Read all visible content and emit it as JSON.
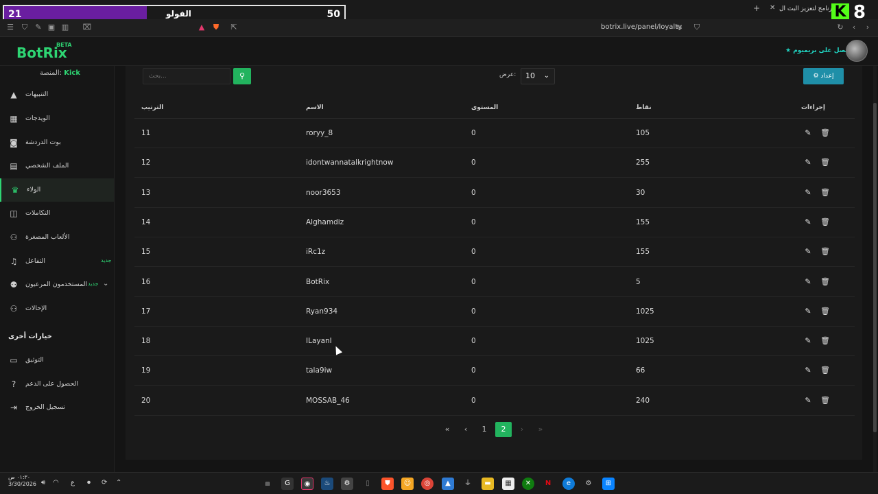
{
  "browser": {
    "url": "botrix.live/panel/loyalty",
    "tab_title": "برنامج لتعزيز البث ال..."
  },
  "overlay": {
    "left_count": "21",
    "label": "الفولو",
    "right_count": "50",
    "progress_fraction": 0.42,
    "fill_color": "#6a1ea0",
    "kick_logo": "K",
    "kick_number": "8"
  },
  "header": {
    "logo": "BotRix",
    "beta": "BETA",
    "premium": "احصل على بريميوم"
  },
  "sidebar": {
    "platform_label": "المنصة:",
    "platform_value": "Kick",
    "items": [
      {
        "label": "التنبيهات",
        "icon": "warning-icon"
      },
      {
        "label": "الويدجات",
        "icon": "widgets-icon"
      },
      {
        "label": "بوت الدردشة",
        "icon": "robot-icon"
      },
      {
        "label": "الملف الشخصي",
        "icon": "profile-card-icon"
      },
      {
        "label": "الولاء",
        "icon": "trophy-icon"
      },
      {
        "label": "التكاملات",
        "icon": "integrations-icon"
      },
      {
        "label": "الألعاب المصغرة",
        "icon": "gamepad-icon"
      },
      {
        "label": "التفاعل",
        "icon": "music-icon",
        "badge": "جديد"
      },
      {
        "label": "المستخدمون المرعيون",
        "icon": "users-icon",
        "badge": "جديد"
      },
      {
        "label": "الإحالات",
        "icon": "referrals-icon"
      }
    ],
    "section_other": "خيارات أخرى",
    "other_items": [
      {
        "label": "التوثيق",
        "icon": "docs-icon"
      },
      {
        "label": "الحصول على الدعم",
        "icon": "help-icon"
      },
      {
        "label": "تسجيل الخروج",
        "icon": "logout-icon"
      }
    ]
  },
  "controls": {
    "settings_label": "إعداد",
    "show_label": "عرض:",
    "show_value": "10",
    "search_placeholder": "بحث..."
  },
  "table": {
    "headers": {
      "rank": "الترتيب",
      "name": "الاسم",
      "level": "المستوى",
      "points": "نقاط",
      "actions": "إجراءات"
    },
    "rows": [
      {
        "rank": "11",
        "name": "roryy_8",
        "level": "0",
        "points": "105"
      },
      {
        "rank": "12",
        "name": "idontwannatalkrightnow",
        "level": "0",
        "points": "255"
      },
      {
        "rank": "13",
        "name": "noor3653",
        "level": "0",
        "points": "30"
      },
      {
        "rank": "14",
        "name": "Alghamdiz",
        "level": "0",
        "points": "155"
      },
      {
        "rank": "15",
        "name": "iRc1z",
        "level": "0",
        "points": "155"
      },
      {
        "rank": "16",
        "name": "BotRix",
        "level": "0",
        "points": "5"
      },
      {
        "rank": "17",
        "name": "Ryan934",
        "level": "0",
        "points": "1025"
      },
      {
        "rank": "18",
        "name": "ILayanI",
        "level": "0",
        "points": "1025"
      },
      {
        "rank": "19",
        "name": "tala9iw",
        "level": "0",
        "points": "66"
      },
      {
        "rank": "20",
        "name": "MOSSAB_46",
        "level": "0",
        "points": "240"
      }
    ]
  },
  "pagination": {
    "first": "«",
    "prev": "‹",
    "page1": "1",
    "page2": "2",
    "next": "›",
    "last": "»",
    "current": "2"
  },
  "taskbar": {
    "time": "٠١:٣٠ ص",
    "date": "3/30/2026",
    "lang": "ع"
  }
}
